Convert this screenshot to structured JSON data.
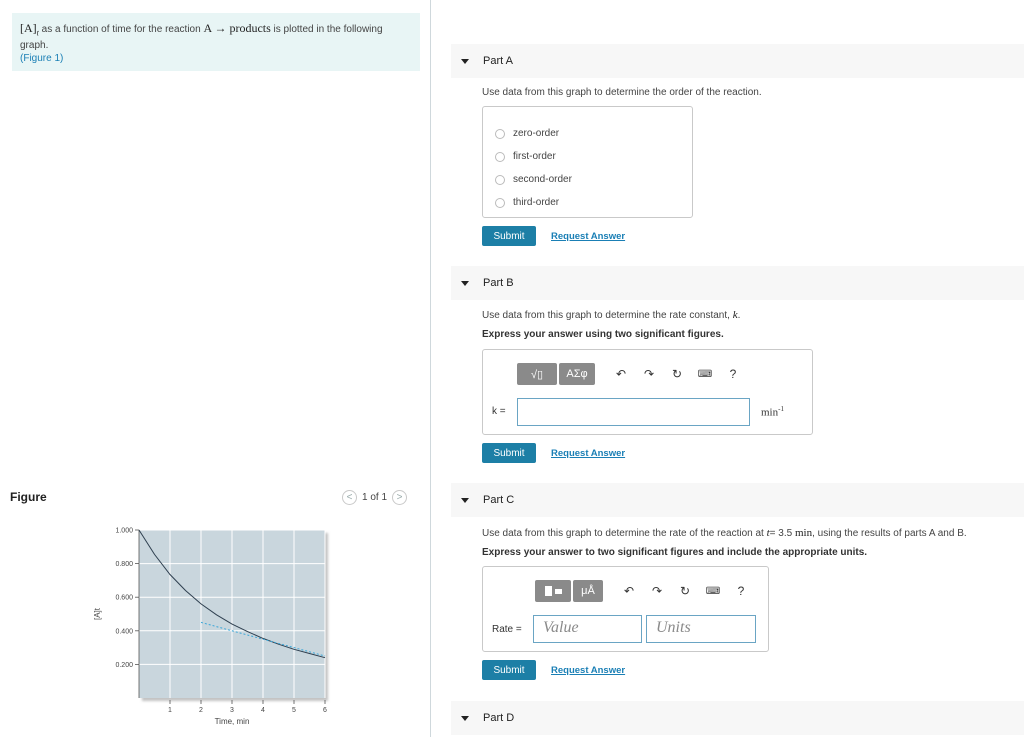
{
  "intro": {
    "math_lead": "[A]",
    "math_sub": "t",
    "text_mid": " as a function of time for the reaction ",
    "reaction": "A → products",
    "text_tail": " is plotted in the following graph.",
    "figure_link": "(Figure 1)"
  },
  "figure": {
    "label": "Figure",
    "pager_text": "1 of 1",
    "prev": "<",
    "next": ">"
  },
  "chart_data": {
    "type": "line",
    "xlabel": "Time, min",
    "ylabel": "[A]t",
    "xlim": [
      0,
      6
    ],
    "ylim": [
      0,
      1.0
    ],
    "x_ticks": [
      "1",
      "2",
      "3",
      "4",
      "5",
      "6"
    ],
    "y_ticks": [
      "0.200",
      "0.400",
      "0.600",
      "0.800",
      "1.000"
    ],
    "grid": true,
    "series": [
      {
        "x": [
          0,
          0.5,
          1,
          1.5,
          2,
          2.5,
          3,
          3.5,
          4,
          4.5,
          5,
          5.5,
          6
        ],
        "y": [
          1.0,
          0.855,
          0.735,
          0.64,
          0.56,
          0.495,
          0.44,
          0.395,
          0.355,
          0.32,
          0.29,
          0.265,
          0.24
        ]
      },
      {
        "x": [
          2,
          6
        ],
        "y": [
          0.45,
          0.25
        ],
        "style": "dashed"
      }
    ]
  },
  "partA": {
    "title": "Part A",
    "prompt": "Use data from this graph to determine the order of the reaction.",
    "options": [
      "zero-order",
      "first-order",
      "second-order",
      "third-order"
    ],
    "submit": "Submit",
    "request": "Request Answer"
  },
  "partB": {
    "title": "Part B",
    "prompt": "Use data from this graph to determine the rate constant, ",
    "prompt_var": "k",
    "prompt_end": ".",
    "instruction": "Express your answer using two significant figures.",
    "toolbar_a": "√▯",
    "toolbar_b": "ΑΣφ",
    "help": "?",
    "label": "k =",
    "unit": "min",
    "unit_exp": "-1",
    "submit": "Submit",
    "request": "Request Answer"
  },
  "partC": {
    "title": "Part C",
    "prompt": "Use data from this graph to determine the rate of the reaction at ",
    "prompt_var": "t",
    "prompt_val": "= 3.5 ",
    "prompt_unit": "min",
    "prompt_end": ", using the results of parts A and B.",
    "instruction": "Express your answer to two significant figures and include the appropriate units.",
    "toolbar_b": "μÅ",
    "help": "?",
    "label": "Rate =",
    "value_placeholder": "Value",
    "units_placeholder": "Units",
    "submit": "Submit",
    "request": "Request Answer"
  },
  "partD": {
    "title": "Part D"
  }
}
